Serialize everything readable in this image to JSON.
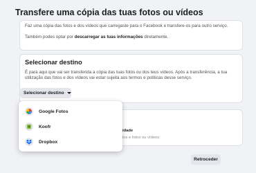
{
  "page": {
    "title": "Transfere uma cópia das tuas fotos ou vídeos"
  },
  "intro": {
    "line1": "Faz uma cópia das fotos e dos vídeos que carregaste para o Facebook e transfere-os para outro serviço.",
    "line2_prefix": "Também podes optar por ",
    "line2_link": "descarregar as tuas informações",
    "line2_suffix": " diretamente."
  },
  "destination": {
    "title": "Selecionar destino",
    "description": "É para aqui que vai ser transferida a cópia das tuas fotos ou dos teus vídeos. Após a transferência, a tua utilização das fotos e dos vídeos vai estar sujeita aos termos e políticas desse serviço.",
    "select_label": "Selecionar destino"
  },
  "dropdown": {
    "options": [
      {
        "label": "Google Fotos",
        "icon": "google-photos-icon"
      },
      {
        "label": "Koofr",
        "icon": "koofr-icon"
      },
      {
        "label": "Dropbox",
        "icon": "dropbox-icon"
      }
    ]
  },
  "obscured_card": {
    "title_fragment": "idade",
    "text_fragment": "los e fotos ou vídeos."
  },
  "footer": {
    "back_label": "Retroceder"
  },
  "colors": {
    "background": "#f0f2f5",
    "card": "#ffffff",
    "button": "#e4e6eb",
    "text": "#1c1e21",
    "secondary_text": "#4b4f56"
  }
}
